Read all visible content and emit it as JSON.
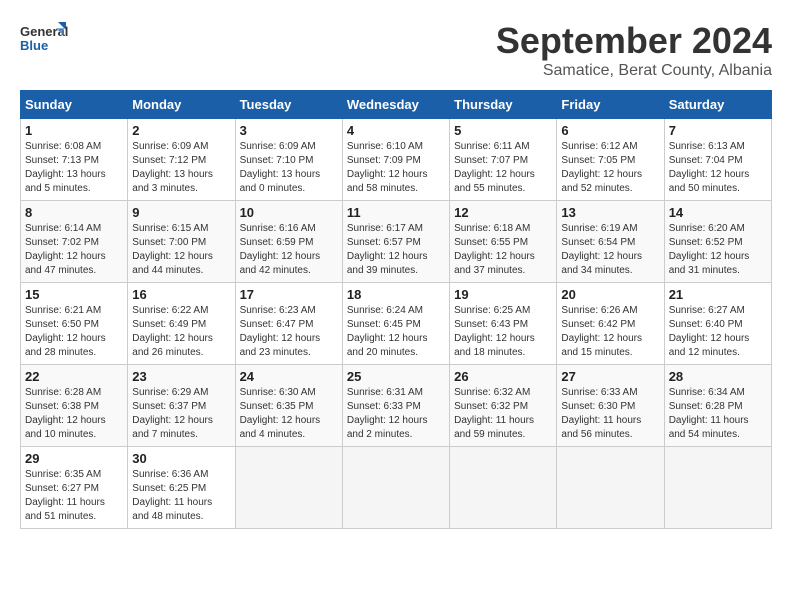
{
  "logo": {
    "line1": "General",
    "line2": "Blue"
  },
  "title": "September 2024",
  "subtitle": "Samatice, Berat County, Albania",
  "weekdays": [
    "Sunday",
    "Monday",
    "Tuesday",
    "Wednesday",
    "Thursday",
    "Friday",
    "Saturday"
  ],
  "weeks": [
    [
      {
        "day": "1",
        "sunrise": "6:08 AM",
        "sunset": "7:13 PM",
        "daylight": "13 hours and 5 minutes."
      },
      {
        "day": "2",
        "sunrise": "6:09 AM",
        "sunset": "7:12 PM",
        "daylight": "13 hours and 3 minutes."
      },
      {
        "day": "3",
        "sunrise": "6:09 AM",
        "sunset": "7:10 PM",
        "daylight": "13 hours and 0 minutes."
      },
      {
        "day": "4",
        "sunrise": "6:10 AM",
        "sunset": "7:09 PM",
        "daylight": "12 hours and 58 minutes."
      },
      {
        "day": "5",
        "sunrise": "6:11 AM",
        "sunset": "7:07 PM",
        "daylight": "12 hours and 55 minutes."
      },
      {
        "day": "6",
        "sunrise": "6:12 AM",
        "sunset": "7:05 PM",
        "daylight": "12 hours and 52 minutes."
      },
      {
        "day": "7",
        "sunrise": "6:13 AM",
        "sunset": "7:04 PM",
        "daylight": "12 hours and 50 minutes."
      }
    ],
    [
      {
        "day": "8",
        "sunrise": "6:14 AM",
        "sunset": "7:02 PM",
        "daylight": "12 hours and 47 minutes."
      },
      {
        "day": "9",
        "sunrise": "6:15 AM",
        "sunset": "7:00 PM",
        "daylight": "12 hours and 44 minutes."
      },
      {
        "day": "10",
        "sunrise": "6:16 AM",
        "sunset": "6:59 PM",
        "daylight": "12 hours and 42 minutes."
      },
      {
        "day": "11",
        "sunrise": "6:17 AM",
        "sunset": "6:57 PM",
        "daylight": "12 hours and 39 minutes."
      },
      {
        "day": "12",
        "sunrise": "6:18 AM",
        "sunset": "6:55 PM",
        "daylight": "12 hours and 37 minutes."
      },
      {
        "day": "13",
        "sunrise": "6:19 AM",
        "sunset": "6:54 PM",
        "daylight": "12 hours and 34 minutes."
      },
      {
        "day": "14",
        "sunrise": "6:20 AM",
        "sunset": "6:52 PM",
        "daylight": "12 hours and 31 minutes."
      }
    ],
    [
      {
        "day": "15",
        "sunrise": "6:21 AM",
        "sunset": "6:50 PM",
        "daylight": "12 hours and 28 minutes."
      },
      {
        "day": "16",
        "sunrise": "6:22 AM",
        "sunset": "6:49 PM",
        "daylight": "12 hours and 26 minutes."
      },
      {
        "day": "17",
        "sunrise": "6:23 AM",
        "sunset": "6:47 PM",
        "daylight": "12 hours and 23 minutes."
      },
      {
        "day": "18",
        "sunrise": "6:24 AM",
        "sunset": "6:45 PM",
        "daylight": "12 hours and 20 minutes."
      },
      {
        "day": "19",
        "sunrise": "6:25 AM",
        "sunset": "6:43 PM",
        "daylight": "12 hours and 18 minutes."
      },
      {
        "day": "20",
        "sunrise": "6:26 AM",
        "sunset": "6:42 PM",
        "daylight": "12 hours and 15 minutes."
      },
      {
        "day": "21",
        "sunrise": "6:27 AM",
        "sunset": "6:40 PM",
        "daylight": "12 hours and 12 minutes."
      }
    ],
    [
      {
        "day": "22",
        "sunrise": "6:28 AM",
        "sunset": "6:38 PM",
        "daylight": "12 hours and 10 minutes."
      },
      {
        "day": "23",
        "sunrise": "6:29 AM",
        "sunset": "6:37 PM",
        "daylight": "12 hours and 7 minutes."
      },
      {
        "day": "24",
        "sunrise": "6:30 AM",
        "sunset": "6:35 PM",
        "daylight": "12 hours and 4 minutes."
      },
      {
        "day": "25",
        "sunrise": "6:31 AM",
        "sunset": "6:33 PM",
        "daylight": "12 hours and 2 minutes."
      },
      {
        "day": "26",
        "sunrise": "6:32 AM",
        "sunset": "6:32 PM",
        "daylight": "11 hours and 59 minutes."
      },
      {
        "day": "27",
        "sunrise": "6:33 AM",
        "sunset": "6:30 PM",
        "daylight": "11 hours and 56 minutes."
      },
      {
        "day": "28",
        "sunrise": "6:34 AM",
        "sunset": "6:28 PM",
        "daylight": "11 hours and 54 minutes."
      }
    ],
    [
      {
        "day": "29",
        "sunrise": "6:35 AM",
        "sunset": "6:27 PM",
        "daylight": "11 hours and 51 minutes."
      },
      {
        "day": "30",
        "sunrise": "6:36 AM",
        "sunset": "6:25 PM",
        "daylight": "11 hours and 48 minutes."
      },
      null,
      null,
      null,
      null,
      null
    ]
  ]
}
